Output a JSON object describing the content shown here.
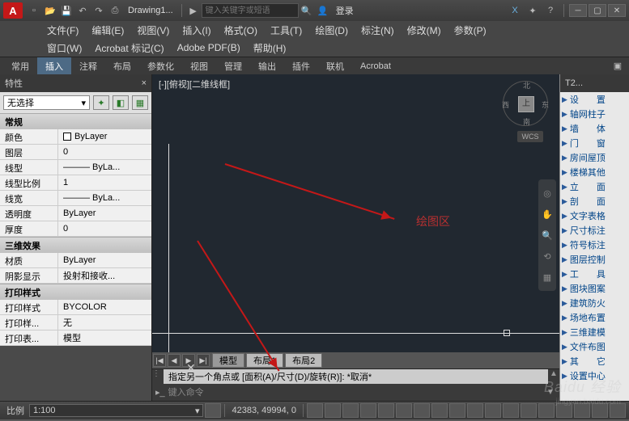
{
  "logo": "A",
  "titlebar": {
    "doc_name": "Drawing1...",
    "search_placeholder": "键入关键字或短语",
    "login": "登录",
    "help_char": "?",
    "x_char": "X"
  },
  "menu1": [
    "文件(F)",
    "编辑(E)",
    "视图(V)",
    "插入(I)",
    "格式(O)",
    "工具(T)",
    "绘图(D)",
    "标注(N)",
    "修改(M)",
    "参数(P)"
  ],
  "menu2": [
    "窗口(W)",
    "Acrobat 标记(C)",
    "Adobe PDF(B)",
    "帮助(H)"
  ],
  "ribbon": {
    "tabs": [
      "常用",
      "插入",
      "注释",
      "布局",
      "参数化",
      "视图",
      "管理",
      "输出",
      "插件",
      "联机",
      "Acrobat"
    ],
    "active": 1
  },
  "props": {
    "title": "特性",
    "selection": "无选择",
    "cats": {
      "general": "常规",
      "threed": "三维效果",
      "print": "打印样式"
    },
    "general": [
      {
        "k": "颜色",
        "v": "ByLayer",
        "sw": true
      },
      {
        "k": "图层",
        "v": "0"
      },
      {
        "k": "线型",
        "v": "——— ByLa..."
      },
      {
        "k": "线型比例",
        "v": "1"
      },
      {
        "k": "线宽",
        "v": "——— ByLa..."
      },
      {
        "k": "透明度",
        "v": "ByLayer"
      },
      {
        "k": "厚度",
        "v": "0"
      }
    ],
    "threed": [
      {
        "k": "材质",
        "v": "ByLayer"
      },
      {
        "k": "阴影显示",
        "v": "投射和接收..."
      }
    ],
    "print": [
      {
        "k": "打印样式",
        "v": "BYCOLOR"
      },
      {
        "k": "打印样...",
        "v": "无"
      },
      {
        "k": "打印表...",
        "v": "模型"
      }
    ]
  },
  "canvas": {
    "view_label": "[-][俯视][二维线框]",
    "compass": {
      "n": "北",
      "s": "南",
      "e": "东",
      "w": "西",
      "face": "上"
    },
    "wcs": "WCS",
    "draw_area_label": "绘图区",
    "cursor_x": "✕"
  },
  "model_tabs": {
    "nav": [
      "|◀",
      "◀",
      "▶",
      "▶|"
    ],
    "tabs": [
      "模型",
      "布局1",
      "布局2"
    ]
  },
  "cmd": {
    "history": "指定另一个角点或 [面积(A)/尺寸(D)/旋转(R)]:  *取消*",
    "prompt_icon": "▸_",
    "placeholder": "键入命令"
  },
  "tool_palette": {
    "title": "T2...",
    "items": [
      "设　　置",
      "轴网柱子",
      "墙　　体",
      "门　　窗",
      "房间屋顶",
      "楼梯其他",
      "立　　面",
      "剖　　面",
      "文字表格",
      "尺寸标注",
      "符号标注",
      "图层控制",
      "工　　具",
      "图块图案",
      "建筑防火",
      "场地布置",
      "三维建模",
      "文件布图",
      "其　　它",
      "设置中心"
    ]
  },
  "status": {
    "scale_label": "比例",
    "scale_value": "1:100",
    "coords": "42383, 49994, 0"
  },
  "watermark": {
    "main": "Baidu 经验",
    "sub": "jingyan.baidu.com"
  }
}
